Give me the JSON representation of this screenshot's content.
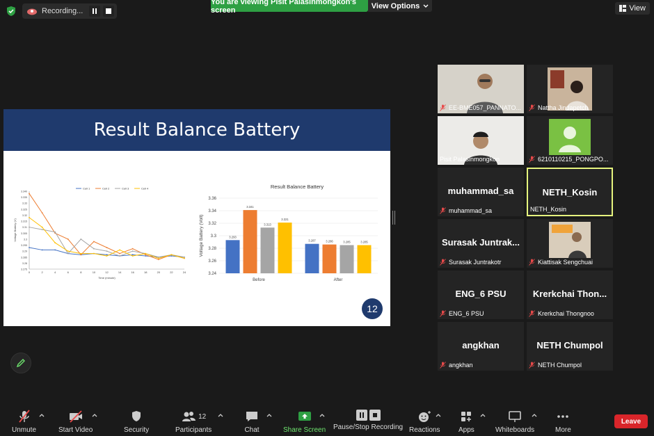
{
  "top": {
    "recording_label": "Recording...",
    "viewing_banner": "You are viewing Pisit Palasinmongkon's screen",
    "view_options": "View Options",
    "view_label": "View"
  },
  "share": {
    "slide_title": "Result Balance Battery",
    "slide_number": "12"
  },
  "chart_data": [
    {
      "type": "line",
      "title": "",
      "xlabel": "Time (minute)",
      "ylabel": "Voltage Battery (V)",
      "ylim": [
        3.275,
        3.34
      ],
      "y_ticks": [
        "3.340",
        "3.335",
        "3.33",
        "3.325",
        "3.32",
        "3.315",
        "3.31",
        "3.305",
        "3.3",
        "3.295",
        "3.29",
        "3.285",
        "3.28",
        "3.275"
      ],
      "x_ticks": [
        "0",
        "2",
        "4",
        "6",
        "8",
        "10",
        "12",
        "14",
        "16",
        "18",
        "20",
        "22",
        "24"
      ],
      "x": [
        0,
        2,
        4,
        6,
        8,
        10,
        12,
        14,
        16,
        18,
        20,
        22,
        24
      ],
      "legend": "top",
      "series": [
        {
          "name": "Cell 1",
          "color": "#4472c4",
          "values": [
            3.293,
            3.291,
            3.291,
            3.288,
            3.287,
            3.288,
            3.287,
            3.286,
            3.287,
            3.286,
            3.285,
            3.286,
            3.285
          ]
        },
        {
          "name": "Cell 2",
          "color": "#ed7d31",
          "values": [
            3.338,
            3.322,
            3.305,
            3.3,
            3.287,
            3.298,
            3.293,
            3.288,
            3.292,
            3.287,
            3.283,
            3.287,
            3.284
          ]
        },
        {
          "name": "Cell 3",
          "color": "#a5a5a5",
          "values": [
            3.31,
            3.308,
            3.306,
            3.288,
            3.3,
            3.292,
            3.29,
            3.286,
            3.29,
            3.288,
            3.285,
            3.287,
            3.285
          ]
        },
        {
          "name": "Cell 4",
          "color": "#ffc000",
          "values": [
            3.318,
            3.31,
            3.297,
            3.29,
            3.288,
            3.288,
            3.286,
            3.291,
            3.286,
            3.288,
            3.284,
            3.287,
            3.284
          ]
        }
      ]
    },
    {
      "type": "bar",
      "title": "Result Balance Battery",
      "xlabel": "",
      "ylabel": "Voltage Battery (Volt)",
      "ylim": [
        3.24,
        3.36
      ],
      "y_ticks": [
        "3.36",
        "3.34",
        "3.32",
        "3.3",
        "3.28",
        "3.26",
        "3.24"
      ],
      "categories": [
        "Before",
        "After"
      ],
      "series": [
        {
          "name": "",
          "color": "#4472c4",
          "values": [
            3.293,
            3.287
          ],
          "labels": [
            "3.293",
            "3.287"
          ]
        },
        {
          "name": "",
          "color": "#ed7d31",
          "values": [
            3.341,
            3.286
          ],
          "labels": [
            "3.341",
            "3.286"
          ]
        },
        {
          "name": "",
          "color": "#a5a5a5",
          "values": [
            3.313,
            3.285
          ],
          "labels": [
            "3.313",
            "3.285"
          ]
        },
        {
          "name": "",
          "color": "#ffc000",
          "values": [
            3.321,
            3.285
          ],
          "labels": [
            "3.321",
            "3.285"
          ]
        }
      ]
    }
  ],
  "gallery": {
    "tiles": [
      {
        "caption": "EE-BME057_PANNATO...",
        "muted": true,
        "video": true,
        "big": ""
      },
      {
        "caption": "Nattha Jindapetch",
        "muted": true,
        "video": true,
        "big": ""
      },
      {
        "caption": "Pisit Palasinmongkon",
        "muted": false,
        "video": true,
        "big": ""
      },
      {
        "caption": "6210110215_PONGPO...",
        "muted": true,
        "video": false,
        "big": ""
      },
      {
        "caption": "muhammad_sa",
        "muted": true,
        "video": false,
        "big": "muhammad_sa"
      },
      {
        "caption": "NETH_Kosin",
        "muted": false,
        "video": false,
        "big": "NETH_Kosin"
      },
      {
        "caption": "Surasak Juntrakotr",
        "muted": true,
        "video": false,
        "big": "Surasak Juntrak..."
      },
      {
        "caption": "Kiattisak Sengchuai",
        "muted": true,
        "video": true,
        "big": ""
      },
      {
        "caption": "ENG_6 PSU",
        "muted": true,
        "video": false,
        "big": "ENG_6 PSU"
      },
      {
        "caption": "Krerkchai Thongnoo",
        "muted": true,
        "video": false,
        "big": "Krerkchai Thon..."
      },
      {
        "caption": "angkhan",
        "muted": true,
        "video": false,
        "big": "angkhan"
      },
      {
        "caption": "NETH Chumpol",
        "muted": true,
        "video": false,
        "big": "NETH Chumpol"
      }
    ]
  },
  "toolbar": {
    "unmute": "Unmute",
    "start_video": "Start Video",
    "security": "Security",
    "participants": "Participants",
    "participants_count": "12",
    "chat": "Chat",
    "share_screen": "Share Screen",
    "pause_stop": "Pause/Stop Recording",
    "reactions": "Reactions",
    "apps": "Apps",
    "whiteboards": "Whiteboards",
    "more": "More",
    "leave": "Leave"
  },
  "colors": {
    "accent_green": "#2ea043",
    "slide_blue": "#1f3a6d",
    "active_border": "#e6f57e",
    "leave_red": "#d9252a"
  }
}
